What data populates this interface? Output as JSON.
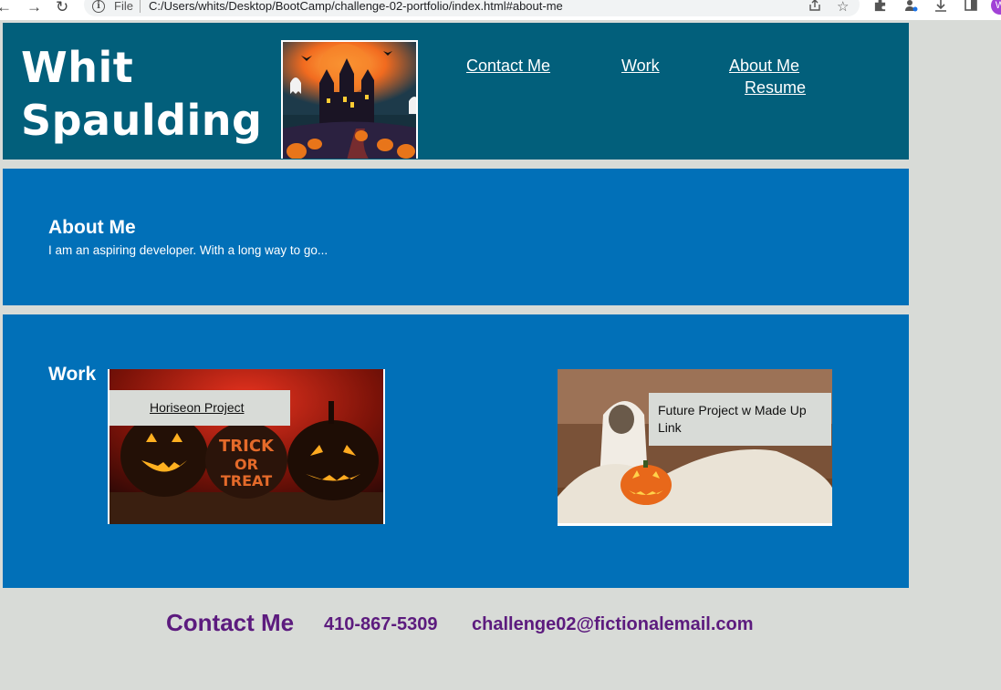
{
  "browser": {
    "back_icon": "←",
    "forward_icon": "→",
    "reload_icon": "↻",
    "file_label": "File",
    "url": "C:/Users/whits/Desktop/BootCamp/challenge-02-portfolio/index.html#about-me",
    "profile_initial": "W"
  },
  "header": {
    "title": "Whit Spaulding",
    "nav": {
      "contact": "Contact Me",
      "work": "Work",
      "about": "About Me",
      "resume": "Resume"
    }
  },
  "about": {
    "heading": "About Me",
    "text": "I am an aspiring developer. With a long way to go..."
  },
  "work": {
    "heading": "Work",
    "projects": [
      {
        "label": "Horiseon Project"
      },
      {
        "label": "Future Project w Made Up Link"
      }
    ]
  },
  "footer": {
    "heading": "Contact Me",
    "phone": "410-867-5309",
    "email": "challenge02@fictionalemail.com"
  },
  "colors": {
    "header_bg": "#025f7b",
    "section_bg": "#0170b8",
    "page_bg": "#d8dbd7",
    "footer_text": "#5c1b7e"
  }
}
